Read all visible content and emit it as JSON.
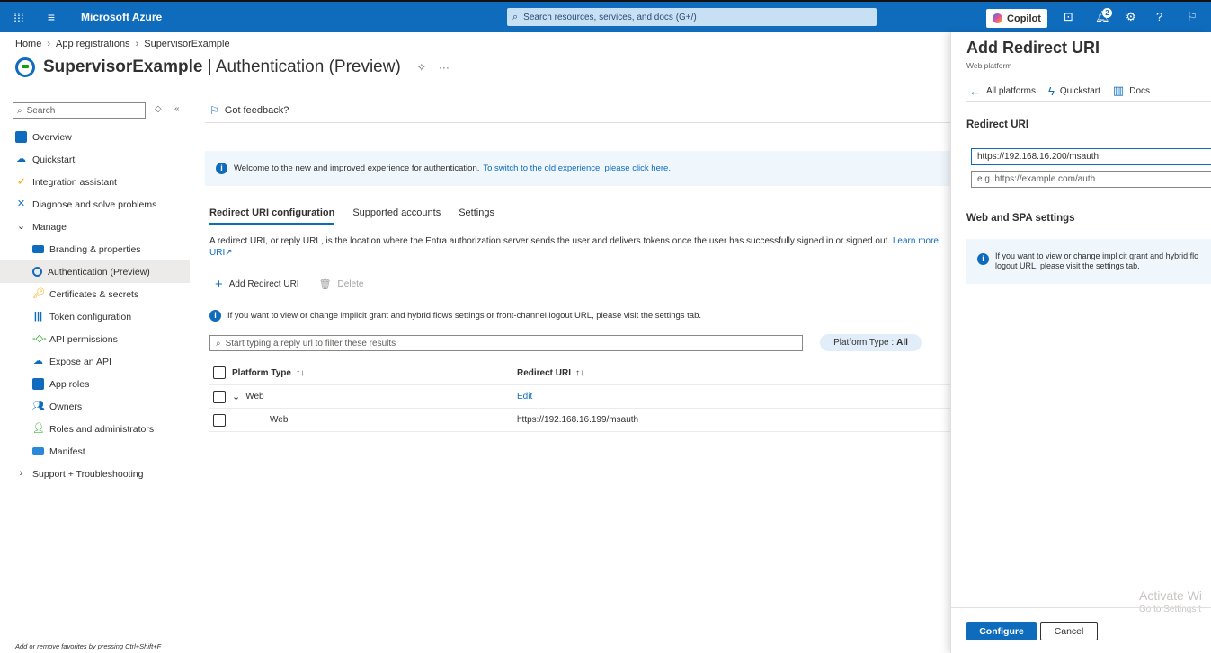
{
  "topbar": {
    "brand": "Microsoft Azure",
    "search_placeholder": "Search resources, services, and docs (G+/)",
    "copilot_label": "Copilot",
    "notification_count": "2"
  },
  "breadcrumb": [
    "Home",
    "App registrations",
    "SupervisorExample"
  ],
  "page": {
    "title_bold": "SupervisorExample",
    "title_rest": " | Authentication (Preview)"
  },
  "sidebar": {
    "search_placeholder": "Search",
    "items": [
      {
        "label": "Overview"
      },
      {
        "label": "Quickstart"
      },
      {
        "label": "Integration assistant"
      },
      {
        "label": "Diagnose and solve problems"
      },
      {
        "label": "Manage"
      },
      {
        "label": "Branding & properties"
      },
      {
        "label": "Authentication (Preview)"
      },
      {
        "label": "Certificates & secrets"
      },
      {
        "label": "Token configuration"
      },
      {
        "label": "API permissions"
      },
      {
        "label": "Expose an API"
      },
      {
        "label": "App roles"
      },
      {
        "label": "Owners"
      },
      {
        "label": "Roles and administrators"
      },
      {
        "label": "Manifest"
      },
      {
        "label": "Support + Troubleshooting"
      }
    ],
    "favorites_hint": "Add or remove favorites by pressing Ctrl+Shift+F"
  },
  "main": {
    "feedback": "Got feedback?",
    "banner_text": "Welcome to the new and improved experience for authentication.",
    "banner_link": "To switch to the old experience, please click here.",
    "tabs": [
      "Redirect URI configuration",
      "Supported accounts",
      "Settings"
    ],
    "description": "A redirect URI, or reply URL, is the location where the Entra authorization server sends the user and delivers tokens once the user has successfully signed in or signed out.",
    "description_link": "Learn more",
    "description_link2": "URI",
    "add_label": "Add Redirect URI",
    "delete_label": "Delete",
    "info_line": "If you want to view or change implicit grant and hybrid flows settings or front-channel logout URL, please visit the settings tab.",
    "filter_placeholder": "Start typing a reply url to filter these results",
    "platform_filter_label": "Platform Type :",
    "platform_filter_value": "All",
    "table": {
      "col_platform": "Platform Type",
      "col_uri": "Redirect URI",
      "group_label": "Web",
      "group_action": "Edit",
      "rows": [
        {
          "platform": "Web",
          "uri": "https://192.168.16.199/msauth"
        }
      ]
    }
  },
  "panel": {
    "title": "Add Redirect URI",
    "subtitle": "Web platform",
    "nav_all": "All platforms",
    "nav_quickstart": "Quickstart",
    "nav_docs": "Docs",
    "section_redirect": "Redirect URI",
    "uri_value": "https://192.168.16.200/msauth",
    "uri_placeholder": "e.g. https://example.com/auth",
    "section_web": "Web and SPA settings",
    "info_text": "If you want to view or change implicit grant and hybrid flo logout URL, please visit the settings tab.",
    "configure": "Configure",
    "cancel": "Cancel",
    "watermark_1": "Activate Wi",
    "watermark_2": "Go to Settings t"
  }
}
